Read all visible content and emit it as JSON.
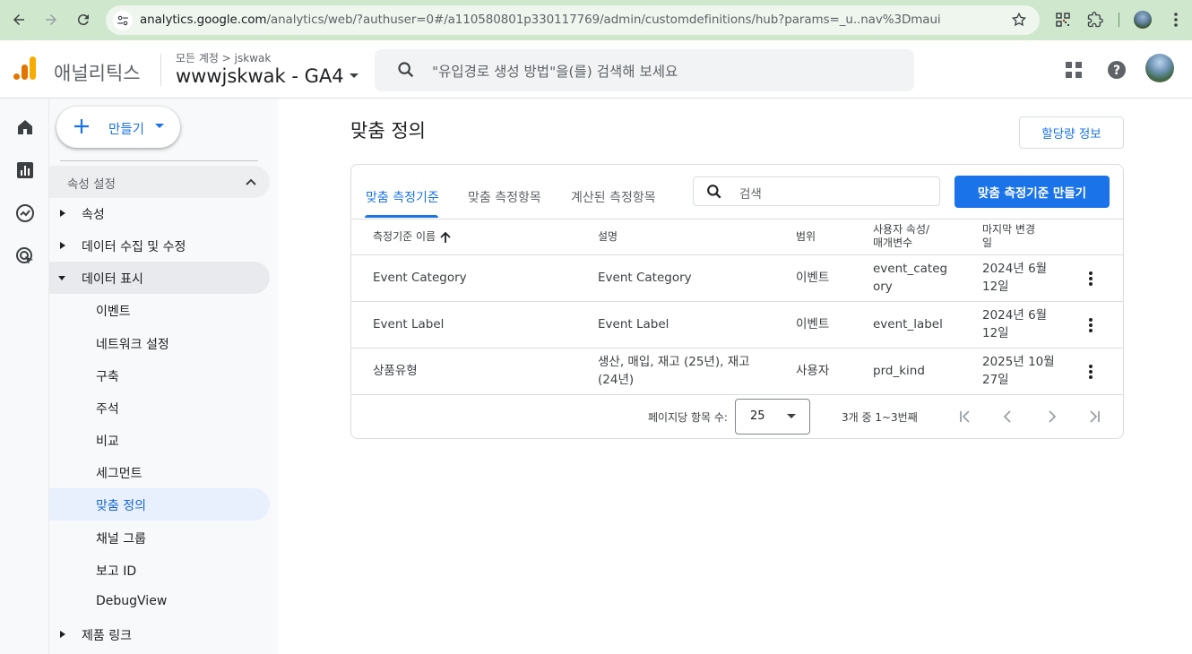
{
  "browser": {
    "url_host": "analytics.google.com",
    "url_path": "/analytics/web/?authuser=0#/a110580801p330117769/admin/customdefinitions/hub?params=_u..nav%3Dmaui"
  },
  "header": {
    "brand": "애널리틱스",
    "breadcrumb": "모든 계정 > jskwak",
    "property": "wwwjskwak - GA4",
    "search_placeholder": "\"유입경로 생성 방법\"을(를) 검색해 보세요"
  },
  "sidebar": {
    "create_label": "만들기",
    "section_title": "속성 설정",
    "items": [
      {
        "label": "속성",
        "type": "collapsed"
      },
      {
        "label": "데이터 수집 및 수정",
        "type": "collapsed"
      },
      {
        "label": "데이터 표시",
        "type": "expanded"
      },
      {
        "label": "이벤트",
        "type": "sub"
      },
      {
        "label": "네트워크 설정",
        "type": "sub"
      },
      {
        "label": "구축",
        "type": "sub"
      },
      {
        "label": "주석",
        "type": "sub"
      },
      {
        "label": "비교",
        "type": "sub"
      },
      {
        "label": "세그먼트",
        "type": "sub"
      },
      {
        "label": "맞춤 정의",
        "type": "selected"
      },
      {
        "label": "채널 그룹",
        "type": "sub"
      },
      {
        "label": "보고 ID",
        "type": "sub"
      },
      {
        "label": "DebugView",
        "type": "sub"
      },
      {
        "label": "제품 링크",
        "type": "collapsed"
      }
    ]
  },
  "main": {
    "title": "맞춤 정의",
    "quota_button": "할당량 정보",
    "tabs": [
      "맞춤 측정기준",
      "맞춤 측정항목",
      "계산된 측정항목"
    ],
    "search_placeholder": "검색",
    "create_button": "맞춤 측정기준 만들기",
    "columns": [
      "측정기준 이름",
      "설명",
      "범위",
      "사용자 속성/\n매개변수",
      "마지막 변경\n일"
    ],
    "rows": [
      {
        "name": "Event Category",
        "description": "Event Category",
        "scope": "이벤트",
        "param": "event_categ\nory",
        "changed": "2024년 6월\n12일"
      },
      {
        "name": "Event Label",
        "description": "Event Label",
        "scope": "이벤트",
        "param": "event_label",
        "changed": "2024년 6월\n12일"
      },
      {
        "name": "상품유형",
        "description": "생산, 매입, 재고 (25년), 재고\n(24년)",
        "scope": "사용자",
        "param": "prd_kind",
        "changed": "2025년 10월\n27일"
      }
    ],
    "pager": {
      "per_page_label": "페이지당 항목 수:",
      "per_page_value": "25",
      "range": "3개 중 1~3번째"
    }
  },
  "colors": {
    "accent": "#1a73e8",
    "chrome_bar": "#cfe7cd",
    "selected_bg": "#e8f0fe"
  }
}
